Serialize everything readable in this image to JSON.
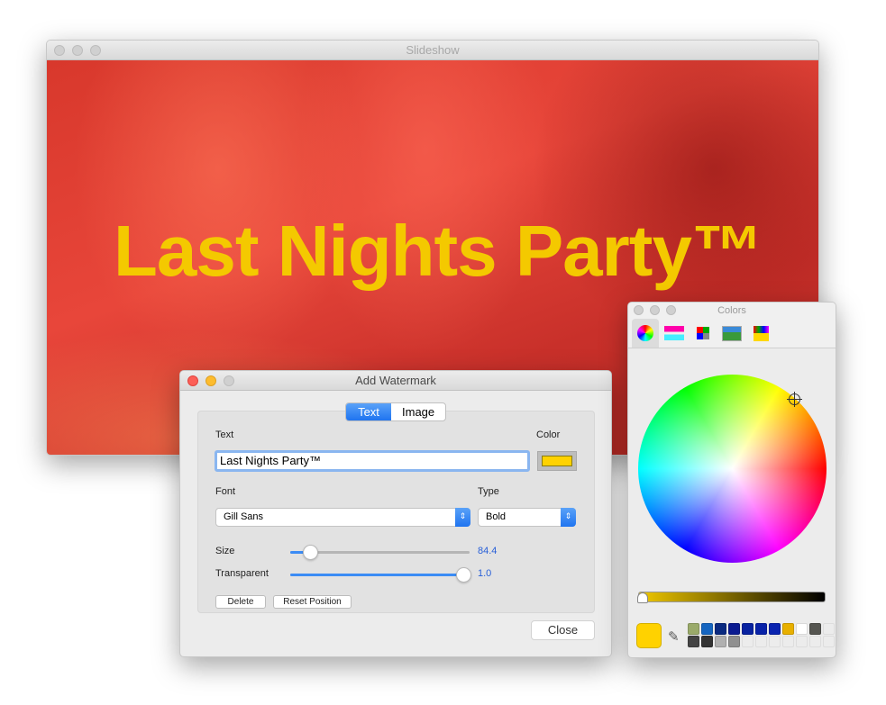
{
  "slideshow": {
    "title": "Slideshow",
    "watermark_text": "Last Nights Party™",
    "watermark_color": "#f4c900"
  },
  "dialog": {
    "title": "Add Watermark",
    "tabs": [
      {
        "label": "Text",
        "selected": true
      },
      {
        "label": "Image",
        "selected": false
      }
    ],
    "text_label": "Text",
    "text_value": "Last Nights Party™",
    "color_label": "Color",
    "color_value": "#ffd200",
    "font_label": "Font",
    "font_value": "Gill Sans",
    "type_label": "Type",
    "type_value": "Bold",
    "size_label": "Size",
    "size_value": "84.4",
    "size_fraction": 0.12,
    "transparent_label": "Transparent",
    "transparent_value": "1.0",
    "transparent_fraction": 1.0,
    "delete_label": "Delete",
    "reset_label": "Reset Position",
    "close_label": "Close"
  },
  "colors": {
    "title": "Colors",
    "tabs": [
      "color-wheel",
      "color-sliders",
      "color-palettes",
      "image-palettes",
      "crayons"
    ],
    "current_color": "#ffd200",
    "brightness_fraction": 0.0,
    "swatches": [
      "#9aaa6a",
      "#1565c0",
      "#0a2a80",
      "#0a1a90",
      "#0822a0",
      "#0822a8",
      "#0a24b0",
      "#e8b000",
      "#ffffff",
      "#555550",
      "",
      "#444444",
      "#333333",
      "#b0b0b0",
      "#909090",
      "",
      "",
      "",
      "",
      "",
      "",
      ""
    ]
  }
}
